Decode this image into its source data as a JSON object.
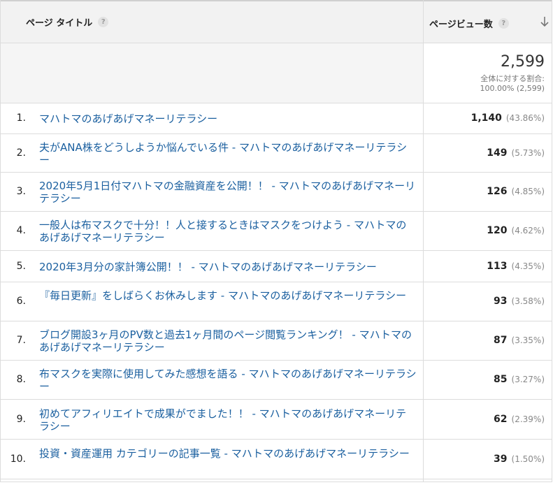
{
  "header": {
    "title_col": "ページ タイトル",
    "metric_col": "ページビュー数",
    "help_glyph": "?"
  },
  "summary": {
    "total": "2,599",
    "label": "全体に対する割合:",
    "pct": "100.00% (2,599)"
  },
  "rows": [
    {
      "rank": "1.",
      "title": "マハトマのあげあげマネーリテラシー",
      "views": "1,140",
      "pct": "(43.86%)"
    },
    {
      "rank": "2.",
      "title": "夫がANA株をどうしようか悩んでいる件 - マハトマのあげあげマネーリテラシー",
      "views": "149",
      "pct": "(5.73%)"
    },
    {
      "rank": "3.",
      "title": "2020年5月1日付マハトマの金融資産を公開！！ - マハトマのあげあげマネーリテラシー",
      "views": "126",
      "pct": "(4.85%)"
    },
    {
      "rank": "4.",
      "title": "一般人は布マスクで十分！！人と接するときはマスクをつけよう - マハトマのあげあげマネーリテラシー",
      "views": "120",
      "pct": "(4.62%)"
    },
    {
      "rank": "5.",
      "title": "2020年3月分の家計簿公開！！ - マハトマのあげあげマネーリテラシー",
      "views": "113",
      "pct": "(4.35%)"
    },
    {
      "rank": "6.",
      "title": "『毎日更新』をしばらくお休みします - マハトマのあげあげマネーリテラシー",
      "views": "93",
      "pct": "(3.58%)"
    },
    {
      "rank": "7.",
      "title": "ブログ開設3ヶ月のPV数と過去1ヶ月間のページ閲覧ランキング！ - マハトマのあげあげマネーリテラシー",
      "views": "87",
      "pct": "(3.35%)"
    },
    {
      "rank": "8.",
      "title": "布マスクを実際に使用してみた感想を語る - マハトマのあげあげマネーリテラシー",
      "views": "85",
      "pct": "(3.27%)"
    },
    {
      "rank": "9.",
      "title": "初めてアフィリエイトで成果がでました！！ - マハトマのあげあげマネーリテラシー",
      "views": "62",
      "pct": "(2.39%)"
    },
    {
      "rank": "10.",
      "title": "投資・資産運用 カテゴリーの記事一覧 - マハトマのあげあげマネーリテラシー",
      "views": "39",
      "pct": "(1.50%)"
    }
  ],
  "icons": {
    "help": "help-icon",
    "sort": "arrow-down-icon"
  },
  "colors": {
    "link": "#1a5f9f",
    "header_bg": "#f2f2f2"
  }
}
